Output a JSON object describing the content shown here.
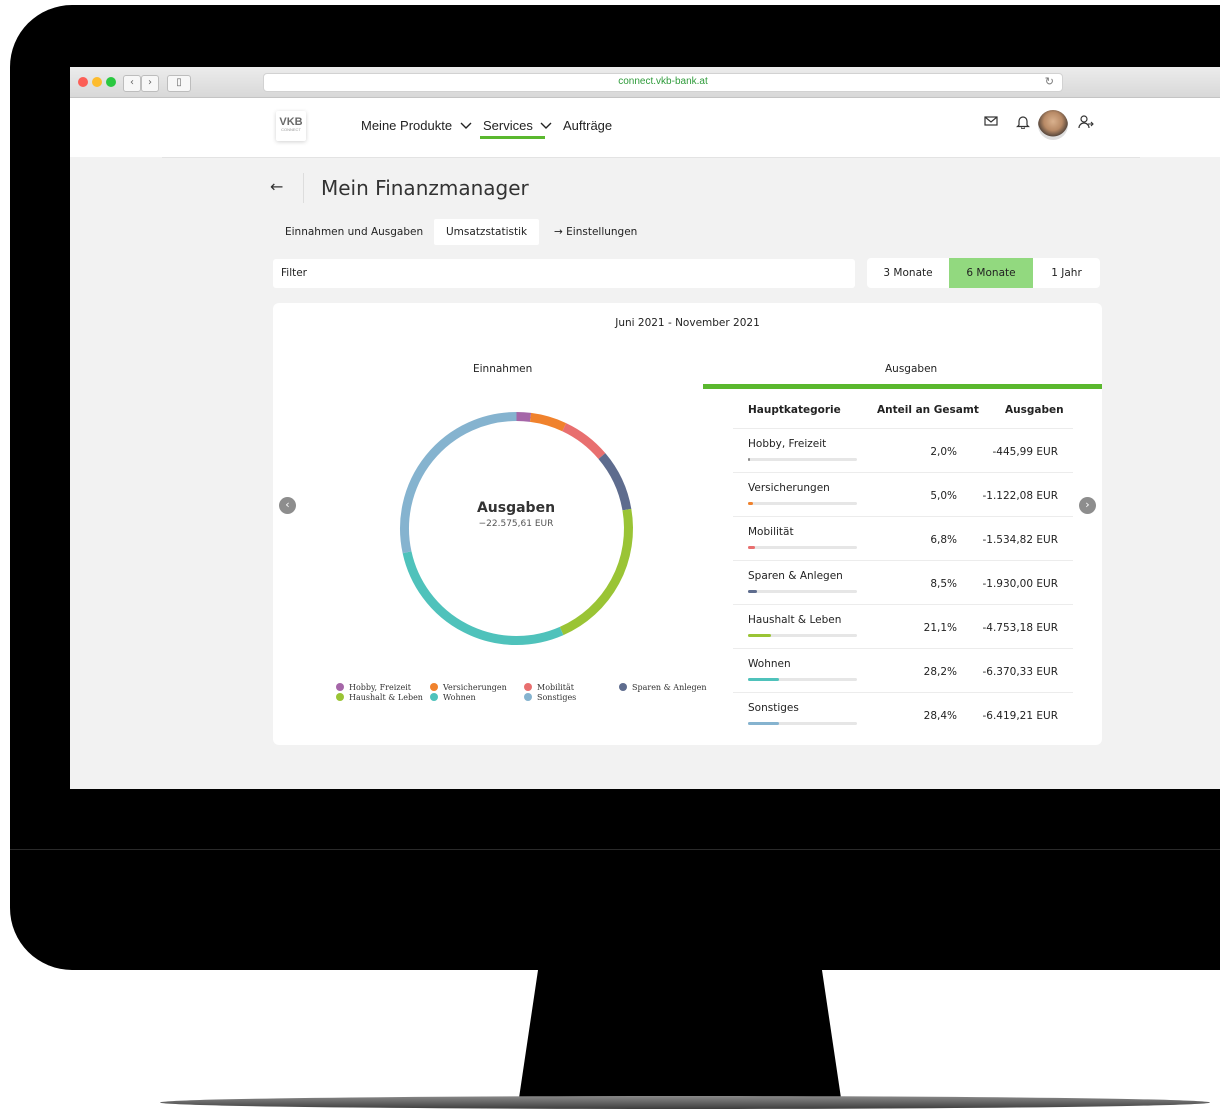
{
  "browser": {
    "url": "connect.vkb-bank.at",
    "back_glyph": "‹",
    "forward_glyph": "›",
    "sidebar_glyph": "▯",
    "reload_glyph": "↻"
  },
  "header": {
    "logo": {
      "text": "VKB",
      "sub": "CONNECT"
    },
    "nav": [
      "Meine Produkte",
      "Services",
      "Aufträge"
    ],
    "active_nav": "Services",
    "icons": [
      "mail-icon",
      "bell-icon",
      "avatar",
      "user-logout-icon"
    ]
  },
  "page": {
    "back_glyph": "←",
    "title": "Mein Finanzmanager",
    "tabs": {
      "income_expenses": "Einnahmen und Ausgaben",
      "stats": "Umsatzstatistik",
      "settings": "Einstellungen"
    },
    "settings_arrow": "→",
    "filter_label": "Filter",
    "periods": [
      "3 Monate",
      "6 Monate",
      "1 Jahr"
    ],
    "active_period": "6 Monate",
    "date_range": "Juni 2021 - November 2021",
    "income_tab": "Einnahmen",
    "expenses_tab": "Ausgaben",
    "prev_glyph": "‹",
    "next_glyph": "›"
  },
  "chart_data": {
    "type": "pie",
    "center_title": "Ausgaben",
    "center_value": "−22.575,61 EUR",
    "categories": [
      "Hobby, Freizeit",
      "Versicherungen",
      "Mobilität",
      "Sparen & Anlegen",
      "Haushalt & Leben",
      "Wohnen",
      "Sonstiges"
    ],
    "values": [
      2.0,
      5.0,
      6.8,
      8.5,
      21.1,
      28.2,
      28.4
    ],
    "colors": [
      "#a566a8",
      "#f0822d",
      "#e86f6f",
      "#5e6c8e",
      "#9ac435",
      "#4fc2bb",
      "#85b3cf"
    ],
    "legend": {
      "placement": "bottom"
    }
  },
  "table": {
    "headers": [
      "Hauptkategorie",
      "Anteil an Gesamt",
      "Ausgaben"
    ],
    "rows": [
      {
        "name": "Hobby, Freizeit",
        "share": "2,0%",
        "amount": "-445,99 EUR",
        "fill": 0.02,
        "color": "#8a8a8a"
      },
      {
        "name": "Versicherungen",
        "share": "5,0%",
        "amount": "-1.122,08 EUR",
        "fill": 0.05,
        "color": "#f0822d"
      },
      {
        "name": "Mobilität",
        "share": "6,8%",
        "amount": "-1.534,82 EUR",
        "fill": 0.068,
        "color": "#e86f6f"
      },
      {
        "name": "Sparen & Anlegen",
        "share": "8,5%",
        "amount": "-1.930,00 EUR",
        "fill": 0.085,
        "color": "#5e6c8e"
      },
      {
        "name": "Haushalt & Leben",
        "share": "21,1%",
        "amount": "-4.753,18 EUR",
        "fill": 0.211,
        "color": "#9ac435"
      },
      {
        "name": "Wohnen",
        "share": "28,2%",
        "amount": "-6.370,33 EUR",
        "fill": 0.282,
        "color": "#4fc2bb"
      },
      {
        "name": "Sonstiges",
        "share": "28,4%",
        "amount": "-6.419,21 EUR",
        "fill": 0.284,
        "color": "#85b3cf"
      }
    ]
  }
}
